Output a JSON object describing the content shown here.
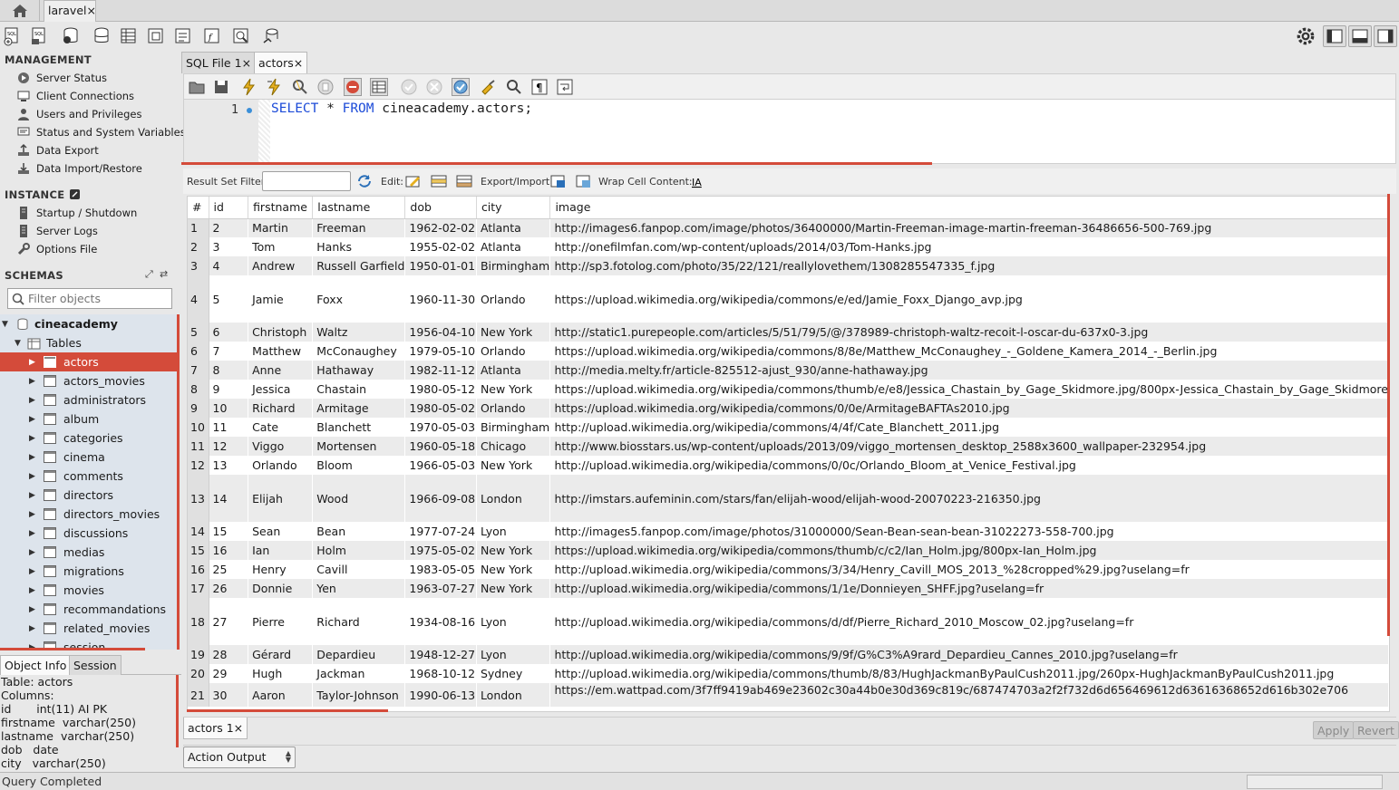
{
  "app": {
    "connection_tab": "laravel",
    "close_glyph": "×"
  },
  "sidebar": {
    "management_title": "MANAGEMENT",
    "management_items": [
      "Server Status",
      "Client Connections",
      "Users and Privileges",
      "Status and System Variables",
      "Data Export",
      "Data Import/Restore"
    ],
    "instance_title": "INSTANCE",
    "instance_items": [
      "Startup / Shutdown",
      "Server Logs",
      "Options File"
    ],
    "schemas_title": "SCHEMAS",
    "filter_placeholder": "Filter objects",
    "schema_name": "cineacademy",
    "tables_label": "Tables",
    "tables": [
      "actors",
      "actors_movies",
      "administrators",
      "album",
      "categories",
      "cinema",
      "comments",
      "directors",
      "directors_movies",
      "discussions",
      "medias",
      "migrations",
      "movies",
      "recommandations",
      "related_movies",
      "session"
    ],
    "selected_table": "actors"
  },
  "object_info": {
    "tab_info": "Object Info",
    "tab_session": "Session",
    "lines": [
      "Table: actors",
      "Columns:",
      "id       int(11) AI PK",
      "firstname  varchar(250)",
      "lastname  varchar(250)",
      "dob   date",
      "city   varchar(250)"
    ]
  },
  "query_tabs": [
    {
      "label": "SQL File 1"
    },
    {
      "label": "actors"
    }
  ],
  "editor": {
    "line_number": "1",
    "kw_select": "SELECT",
    "star": " * ",
    "kw_from": "FROM",
    "target": " cineacademy.actors;"
  },
  "result_toolbar": {
    "filter_label": "Result Set Filter:",
    "edit_label": "Edit:",
    "export_label": "Export/Import:",
    "wrap_label": "Wrap Cell Content:"
  },
  "result": {
    "columns": [
      "#",
      "id",
      "firstname",
      "lastname",
      "dob",
      "city",
      "image"
    ],
    "rows": [
      [
        "1",
        "2",
        "Martin",
        "Freeman",
        "1962-02-02",
        "Atlanta",
        "http://images6.fanpop.com/image/photos/36400000/Martin-Freeman-image-martin-freeman-36486656-500-769.jpg"
      ],
      [
        "2",
        "3",
        "Tom",
        "Hanks",
        "1955-02-02",
        "Atlanta",
        "http://onefilmfan.com/wp-content/uploads/2014/03/Tom-Hanks.jpg"
      ],
      [
        "3",
        "4",
        "Andrew",
        "Russell Garfield",
        "1950-01-01",
        "Birmingham",
        "http://sp3.fotolog.com/photo/35/22/121/reallylovethem/1308285547335_f.jpg"
      ],
      [
        "4",
        "5",
        "Jamie",
        "Foxx",
        "1960-11-30",
        "Orlando",
        "https://upload.wikimedia.org/wikipedia/commons/e/ed/Jamie_Foxx_Django_avp.jpg"
      ],
      [
        "5",
        "6",
        "Christoph",
        "Waltz",
        "1956-04-10",
        "New York",
        "http://static1.purepeople.com/articles/5/51/79/5/@/378989-christoph-waltz-recoit-l-oscar-du-637x0-3.jpg"
      ],
      [
        "6",
        "7",
        "Matthew",
        "McConaughey",
        "1979-05-10",
        "Orlando",
        "https://upload.wikimedia.org/wikipedia/commons/8/8e/Matthew_McConaughey_-_Goldene_Kamera_2014_-_Berlin.jpg"
      ],
      [
        "7",
        "8",
        "Anne",
        "Hathaway",
        "1982-11-12",
        "Atlanta",
        "http://media.melty.fr/article-825512-ajust_930/anne-hathaway.jpg"
      ],
      [
        "8",
        "9",
        "Jessica",
        "Chastain",
        "1980-05-12",
        "New York",
        "https://upload.wikimedia.org/wikipedia/commons/thumb/e/e8/Jessica_Chastain_by_Gage_Skidmore.jpg/800px-Jessica_Chastain_by_Gage_Skidmore"
      ],
      [
        "9",
        "10",
        "Richard",
        "Armitage",
        "1980-05-02",
        "Orlando",
        "https://upload.wikimedia.org/wikipedia/commons/0/0e/ArmitageBAFTAs2010.jpg"
      ],
      [
        "10",
        "11",
        "Cate",
        "Blanchett",
        "1970-05-03",
        "Birmingham",
        "http://upload.wikimedia.org/wikipedia/commons/4/4f/Cate_Blanchett_2011.jpg"
      ],
      [
        "11",
        "12",
        "Viggo",
        "Mortensen",
        "1960-05-18",
        "Chicago",
        "http://www.biosstars.us/wp-content/uploads/2013/09/viggo_mortensen_desktop_2588x3600_wallpaper-232954.jpg"
      ],
      [
        "12",
        "13",
        "Orlando",
        "Bloom",
        "1966-05-03",
        "New York",
        "http://upload.wikimedia.org/wikipedia/commons/0/0c/Orlando_Bloom_at_Venice_Festival.jpg"
      ],
      [
        "13",
        "14",
        "Elijah",
        "Wood",
        "1966-09-08",
        "London",
        "http://imstars.aufeminin.com/stars/fan/elijah-wood/elijah-wood-20070223-216350.jpg"
      ],
      [
        "14",
        "15",
        "Sean",
        "Bean",
        "1977-07-24",
        "Lyon",
        "http://images5.fanpop.com/image/photos/31000000/Sean-Bean-sean-bean-31022273-558-700.jpg"
      ],
      [
        "15",
        "16",
        "Ian",
        "Holm",
        "1975-05-02",
        "New York",
        "https://upload.wikimedia.org/wikipedia/commons/thumb/c/c2/Ian_Holm.jpg/800px-Ian_Holm.jpg"
      ],
      [
        "16",
        "25",
        "Henry",
        "Cavill",
        "1983-05-05",
        "New York",
        "http://upload.wikimedia.org/wikipedia/commons/3/34/Henry_Cavill_MOS_2013_%28cropped%29.jpg?uselang=fr"
      ],
      [
        "17",
        "26",
        "Donnie",
        "Yen",
        "1963-07-27",
        "New York",
        "http://upload.wikimedia.org/wikipedia/commons/1/1e/Donnieyen_SHFF.jpg?uselang=fr"
      ],
      [
        "18",
        "27",
        "Pierre",
        "Richard",
        "1934-08-16",
        "Lyon",
        "http://upload.wikimedia.org/wikipedia/commons/d/df/Pierre_Richard_2010_Moscow_02.jpg?uselang=fr"
      ],
      [
        "19",
        "28",
        "Gérard",
        "Depardieu",
        "1948-12-27",
        "Lyon",
        "http://upload.wikimedia.org/wikipedia/commons/9/9f/G%C3%A9rard_Depardieu_Cannes_2010.jpg?uselang=fr"
      ],
      [
        "20",
        "29",
        "Hugh",
        "Jackman",
        "1968-10-12",
        "Sydney",
        "http://upload.wikimedia.org/wikipedia/commons/thumb/8/83/HughJackmanByPaulCush2011.jpg/260px-HughJackmanByPaulCush2011.jpg"
      ],
      [
        "21",
        "30",
        "Aaron",
        "Taylor-Johnson",
        "1990-06-13",
        "London",
        "https://em.wattpad.com/3f7ff9419ab469e23602c30a44b0e30d369c819c/687474703a2f2f732d6d656469612d63616368652d616b302e706"
      ]
    ]
  },
  "result_tabs": {
    "tab_label": "actors 1",
    "apply_label": "Apply",
    "revert_label": "Revert"
  },
  "output": {
    "selected": "Action Output"
  },
  "status": {
    "text": "Query Completed"
  },
  "colors": {
    "accent_red": "#d44b3a",
    "keyword_blue": "#1c4bd8",
    "tree_bg": "#dde4ec"
  }
}
